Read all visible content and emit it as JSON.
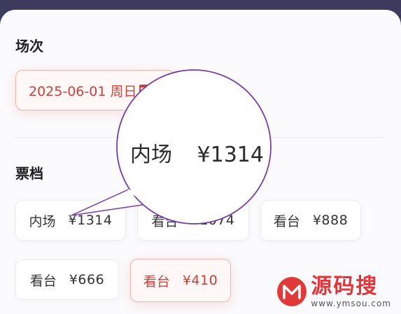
{
  "sheet": {
    "session_title": "场次",
    "tier_title": "票档"
  },
  "session": {
    "selected_date": "2025-06-01 周日"
  },
  "tiers": [
    {
      "name": "内场",
      "price": "¥1314",
      "selected": false
    },
    {
      "name": "看台",
      "price": "¥1074",
      "selected": false
    },
    {
      "name": "看台",
      "price": "¥888",
      "selected": false
    },
    {
      "name": "看台",
      "price": "¥666",
      "selected": false
    },
    {
      "name": "看台",
      "price": "¥410",
      "selected": true
    }
  ],
  "magnifier": {
    "name": "内场",
    "price": "¥1314"
  },
  "watermark": {
    "title": "源码搜",
    "url": "www.ymsou.com"
  },
  "colors": {
    "accent": "#c9413a",
    "backdrop": "#3d3b5e",
    "magnifier_outline": "#7a3aa8"
  }
}
